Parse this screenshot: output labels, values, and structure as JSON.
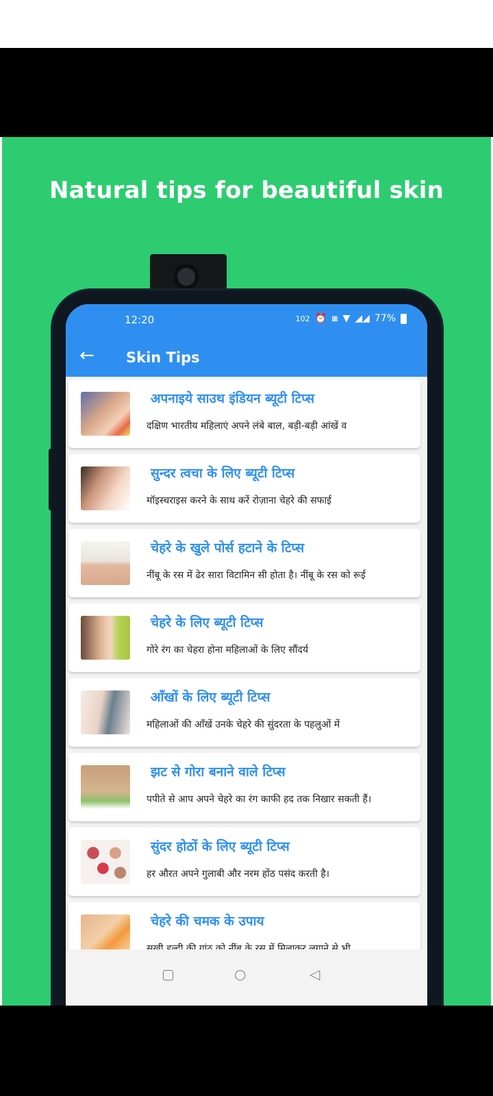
{
  "promo": {
    "headline": "Natural tips for beautiful skin"
  },
  "status_bar": {
    "time": "12:20",
    "indicators": "102",
    "battery": "77%"
  },
  "app_bar": {
    "back_icon": "←",
    "title": "Skin Tips"
  },
  "tips": [
    {
      "title": "अपनाइये साउथ इंडियन ब्यूटी टिप्स",
      "desc": "दक्षिण भारतीय महिलाएं अपने लंबे बाल, बड़ी-बड़ी आंखें व"
    },
    {
      "title": "सुन्दर त्वचा के लिए ब्यूटी टिप्स",
      "desc": "मॉइस्चराइस करने के साथ करें रोज़ाना चेहरे की सफाई"
    },
    {
      "title": "चेहरे के खुले पोर्स हटाने के टिप्स",
      "desc": "नींबू के रस में ढेर सारा विटामिन सी होता है। नींबू के रस को रूई"
    },
    {
      "title": "चेहरे के लिए ब्यूटी टिप्स",
      "desc": "गोरे रंग का चेहरा होना महिलाओं के लिए सौंदर्य"
    },
    {
      "title": "आँखों के लिए ब्यूटी टिप्स",
      "desc": "महिलाओं की आँखें उनके चेहरे की सुंदरता के पहलुओं में"
    },
    {
      "title": "झट से गोरा बनाने वाले टिप्स",
      "desc": "पपीते से आप अपने चेहरे का रंग काफी हद तक निखार सकती हैं।"
    },
    {
      "title": "सुंदर होठों के लिए ब्यूटी टिप्स",
      "desc": "हर औरत अपने गुलाबी और नरम होंठ पसंद करती है।"
    },
    {
      "title": "चेहरे की चमक के उपाय",
      "desc": "सूखी हल्दी की गांठ को नींबू के रस में मिलाकर लगाने से भी"
    }
  ],
  "nav": {
    "recents_icon": "▢",
    "home_icon": "○",
    "back_icon": "◁"
  },
  "colors": {
    "promo_background": "#2dcc70",
    "app_bar": "#2f8ff0",
    "card_title": "#2f8ff0"
  }
}
